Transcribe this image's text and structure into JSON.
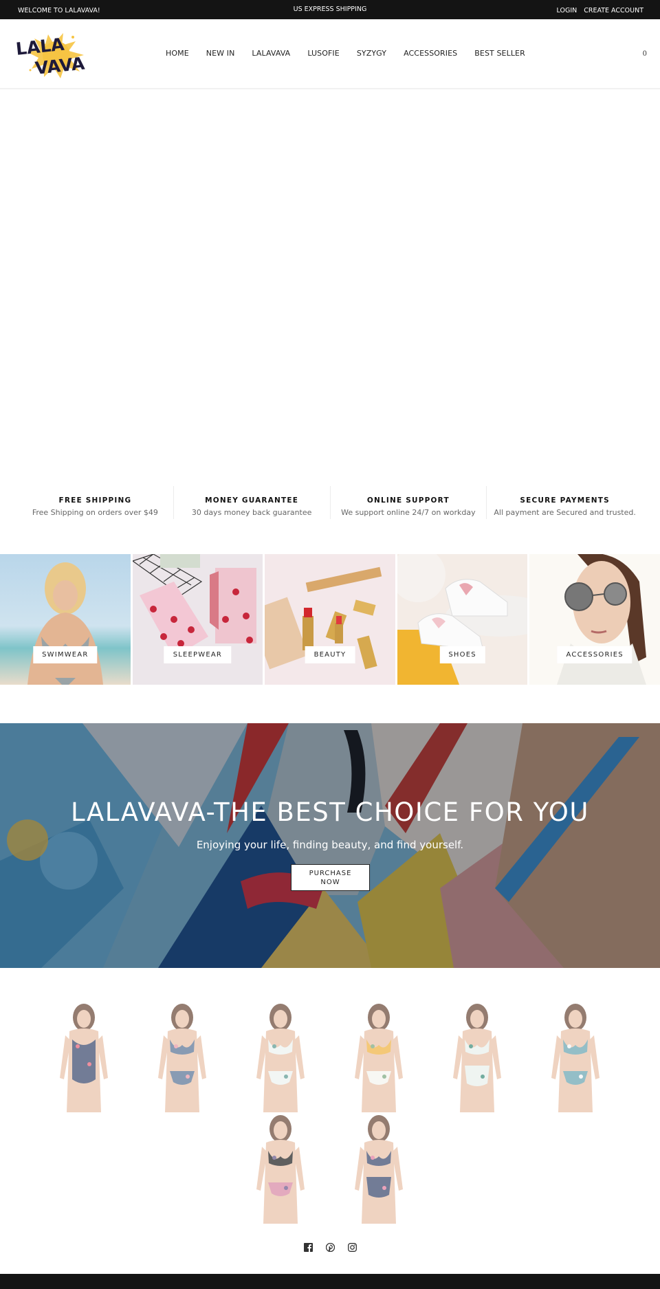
{
  "topbar": {
    "welcome": "WELCOME TO LALAVAVA!",
    "shipping": "US EXPRESS SHIPPING",
    "login": "LOGIN",
    "create_account": "CREATE ACCOUNT"
  },
  "header": {
    "logo_line1": "LALA",
    "logo_line2": "VAVA",
    "nav": [
      {
        "label": "HOME"
      },
      {
        "label": "NEW IN"
      },
      {
        "label": "LALAVAVA"
      },
      {
        "label": "LUSOFIE"
      },
      {
        "label": "SYZYGY"
      },
      {
        "label": "ACCESSORIES"
      },
      {
        "label": "BEST SELLER"
      }
    ],
    "cart_count": "0"
  },
  "services": [
    {
      "title": "FREE SHIPPING",
      "desc": "Free Shipping on orders over $49"
    },
    {
      "title": "MONEY GUARANTEE",
      "desc": "30 days money back guarantee"
    },
    {
      "title": "ONLINE SUPPORT",
      "desc": "We support online 24/7 on workday"
    },
    {
      "title": "SECURE PAYMENTS",
      "desc": "All payment are Secured and trusted."
    }
  ],
  "categories": [
    {
      "label": "SWIMWEAR"
    },
    {
      "label": "SLEEPWEAR"
    },
    {
      "label": "BEAUTY"
    },
    {
      "label": "SHOES"
    },
    {
      "label": "ACCESSORIES"
    }
  ],
  "banner": {
    "headline": "LALAVAVA-THE BEST CHOICE FOR YOU",
    "subheadline": "Enjoying your life, finding beauty, and find yourself.",
    "cta_line1": "PURCHASE",
    "cta_line2": "NOW"
  },
  "products": [
    {
      "name": "floral one-piece swimsuit",
      "top": "#3c4a6e",
      "bottom": "#3c4a6e",
      "accent": "#e8657a"
    },
    {
      "name": "floral high-neck bikini",
      "top": "#5b7596",
      "bottom": "#5b7596",
      "accent": "#e99aa8"
    },
    {
      "name": "white leaf print bikini",
      "top": "#eef3f1",
      "bottom": "#eef3f1",
      "accent": "#5c9b93"
    },
    {
      "name": "yellow wrap top bikini",
      "top": "#f0b443",
      "bottom": "#f5f5ef",
      "accent": "#7caa80"
    },
    {
      "name": "leaf print ruffle bikini",
      "top": "#e9f1ec",
      "bottom": "#e9f1ec",
      "accent": "#3d8d7b"
    },
    {
      "name": "teal leaf triangle bikini",
      "top": "#6ba6b2",
      "bottom": "#6ba6b2",
      "accent": "#f5f5f5"
    },
    {
      "name": "black halter floral bikini",
      "top": "#222222",
      "bottom": "#d98aa6",
      "accent": "#6a5b8c"
    },
    {
      "name": "floral high-waist bikini",
      "top": "#3c4a6e",
      "bottom": "#3c4a6e",
      "accent": "#e47fa0"
    }
  ],
  "social": [
    {
      "name": "facebook"
    },
    {
      "name": "pinterest"
    },
    {
      "name": "instagram"
    }
  ],
  "colors": {
    "topbar_bg": "#141414",
    "logo_yellow": "#f6c443",
    "logo_dark": "#1e1a3a"
  }
}
